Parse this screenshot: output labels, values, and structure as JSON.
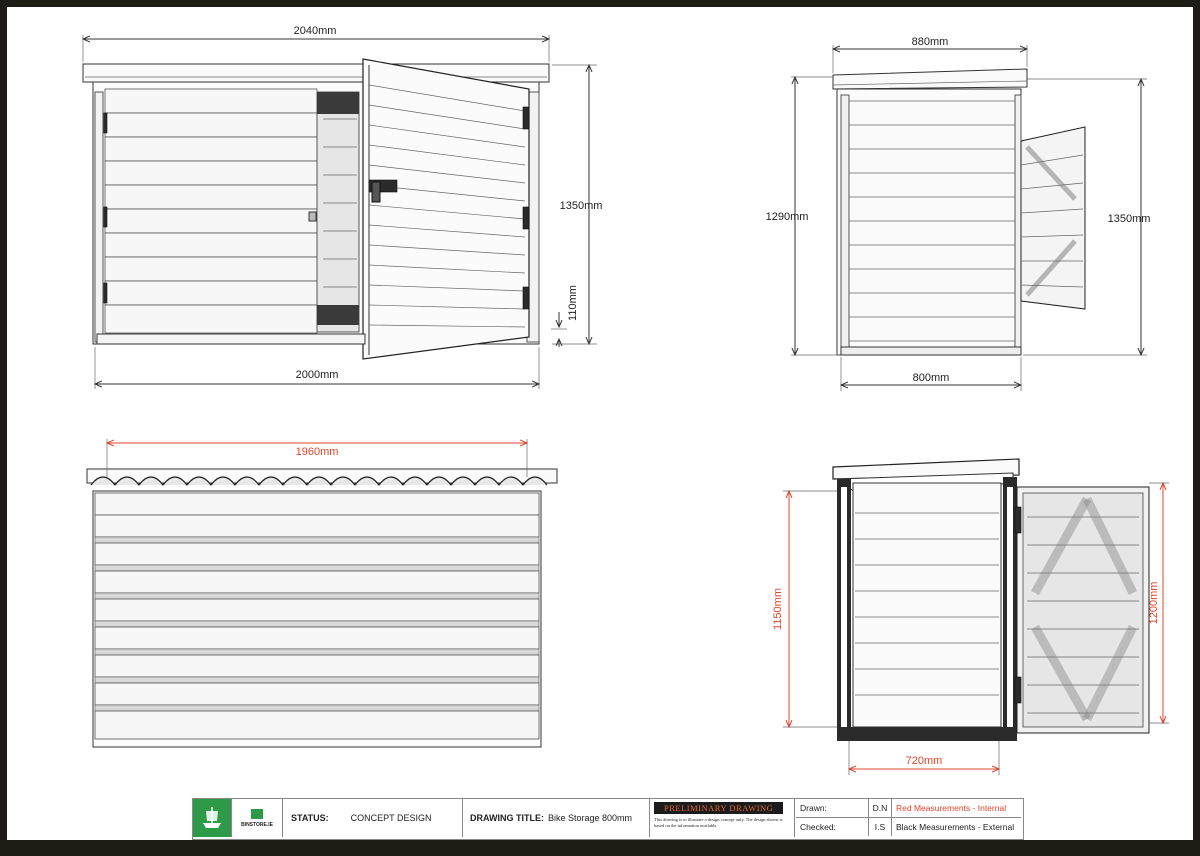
{
  "drawing": {
    "front": {
      "overall_width_top": "2040mm",
      "overall_width_bottom": "2000mm",
      "height": "1350mm",
      "base_gap": "110mm"
    },
    "side": {
      "width_top": "880mm",
      "width_bottom": "800mm",
      "height_left": "1290mm",
      "height_right": "1350mm"
    },
    "rear": {
      "width": "1960mm"
    },
    "section": {
      "width": "720mm",
      "height_left": "1150mm",
      "height_right": "1200mm"
    }
  },
  "title_block": {
    "logo_text": "BINSTORE.IE",
    "status_label": "STATUS:",
    "status_value": "CONCEPT DESIGN",
    "drawing_title_label": "DRAWING TITLE:",
    "drawing_title_value": "Bike Storage 800mm",
    "preliminary_heading": "PRELIMINARY DRAWING",
    "preliminary_note": "This drawing is to illustrate a design concept only. The design shown is based on the information available.",
    "drawn_label": "Drawn:",
    "drawn_value": "D.N",
    "checked_label": "Checked:",
    "checked_value": "I.S",
    "legend_red": "Red Measurements - Internal",
    "legend_black": "Black Measurements - External"
  },
  "colors": {
    "internal": "#e0452b",
    "external": "#222222",
    "logo_green": "#2e9a47"
  }
}
